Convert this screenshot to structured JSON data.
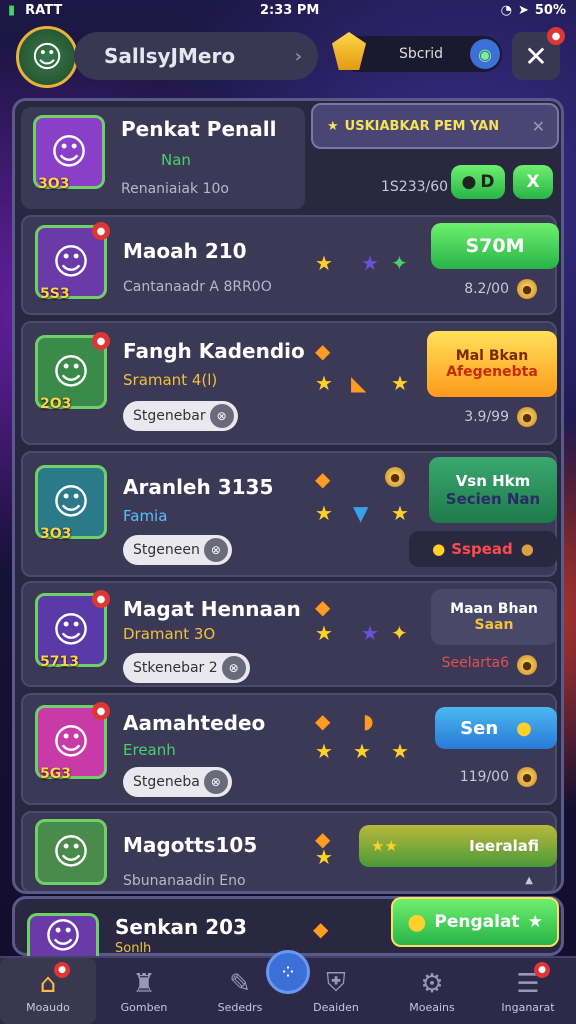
{
  "status": {
    "carrier": "RATT",
    "time": "2:33 PM",
    "battery": "50%"
  },
  "topbar": {
    "username": "SallsyJMero",
    "currency_value": "Sbcrid"
  },
  "banner": {
    "text": "USKIABKAR PEM YAN"
  },
  "rows": [
    {
      "level": "3O3",
      "name": "Penkat Penall",
      "sub": "Nan",
      "note": "Renaniaiak 10o",
      "right_value": "1S233/60",
      "btn1": "D",
      "btn2": "X"
    },
    {
      "level": "5S3",
      "name": "Maoah 210",
      "note": "Cantanaadr A 8RR0O",
      "right_value": "8.2/00",
      "btn_label": "S70M"
    },
    {
      "level": "2O3",
      "name": "Fangh Kadendio",
      "sub": "Sramant 4(l)",
      "tag": "Stgenebar",
      "right_value": "3.9/99",
      "btn_line1": "Mal Bkan",
      "btn_line2": "Afegenebta"
    },
    {
      "level": "3O3",
      "name": "Aranleh 3135",
      "sub": "Famia",
      "tag": "Stgeneen",
      "btn_line1": "Vsn Hkm",
      "btn_line2": "Secien Nan",
      "btn3": "Sspead"
    },
    {
      "level": "5713",
      "name": "Magat Hennaan",
      "sub": "Dramant 3O",
      "tag": "Stkenebar 2",
      "btn_line1": "Maan Bhan",
      "btn_line2": "Saan",
      "btn3": "Seelarta6"
    },
    {
      "level": "5G3",
      "name": "Aamahtedeo",
      "sub": "Ereanh",
      "tag": "Stgeneba",
      "right_value": "119/00",
      "btn_label": "Sen"
    },
    {
      "name": "Magotts105",
      "note": "Sbunanaadin Eno",
      "btn_label": "Ieeralafi"
    },
    {
      "name": "Senkan 203",
      "sub": "Sonlh",
      "btn_label": "Pengalat"
    }
  ],
  "nav": [
    {
      "label": "Moaudo",
      "icon": "home-icon"
    },
    {
      "label": "Gomben",
      "icon": "castle-icon"
    },
    {
      "label": "Sededrs",
      "icon": "chat-icon"
    },
    {
      "label": "Deaiden",
      "icon": "shield-icon"
    },
    {
      "label": "Moeains",
      "icon": "gear-icon"
    },
    {
      "label": "Inganarat",
      "icon": "menu-icon"
    }
  ],
  "colors": {
    "accent": "#ffcf2a",
    "panel": "#2a2840",
    "green": "#28b448"
  }
}
